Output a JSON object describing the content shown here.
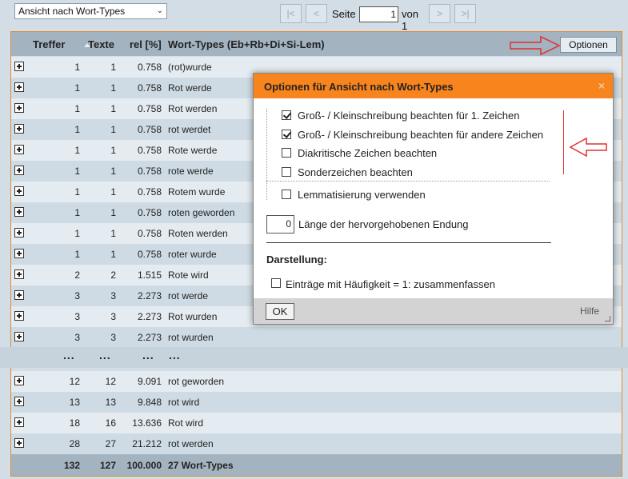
{
  "toolbar": {
    "view_select": "Ansicht nach Wort-Types",
    "pager": {
      "first": "|<",
      "prev": "<",
      "page_label": "Seite",
      "page_value": "1",
      "of_label": "von 1",
      "next": ">",
      "last": ">|"
    }
  },
  "table": {
    "headers": {
      "treffer": "Treffer",
      "texte": "Texte",
      "rel": "rel [%]",
      "wort": "Wort-Types (Eb+Rb+Di+Si-Lem)"
    },
    "options_button": "Optionen",
    "rows": [
      {
        "treffer": "1",
        "texte": "1",
        "rel": "0.758",
        "wort": "(rot)wurde"
      },
      {
        "treffer": "1",
        "texte": "1",
        "rel": "0.758",
        "wort": "Rot werde"
      },
      {
        "treffer": "1",
        "texte": "1",
        "rel": "0.758",
        "wort": "Rot werden"
      },
      {
        "treffer": "1",
        "texte": "1",
        "rel": "0.758",
        "wort": "rot werdet"
      },
      {
        "treffer": "1",
        "texte": "1",
        "rel": "0.758",
        "wort": "Rote werde"
      },
      {
        "treffer": "1",
        "texte": "1",
        "rel": "0.758",
        "wort": "rote werde"
      },
      {
        "treffer": "1",
        "texte": "1",
        "rel": "0.758",
        "wort": "Rotem wurde"
      },
      {
        "treffer": "1",
        "texte": "1",
        "rel": "0.758",
        "wort": "roten geworden"
      },
      {
        "treffer": "1",
        "texte": "1",
        "rel": "0.758",
        "wort": "Roten werden"
      },
      {
        "treffer": "1",
        "texte": "1",
        "rel": "0.758",
        "wort": "roter wurde"
      },
      {
        "treffer": "2",
        "texte": "2",
        "rel": "1.515",
        "wort": "Rote wird"
      },
      {
        "treffer": "3",
        "texte": "3",
        "rel": "2.273",
        "wort": "rot werde"
      },
      {
        "treffer": "3",
        "texte": "3",
        "rel": "2.273",
        "wort": "Rot wurden"
      },
      {
        "treffer": "3",
        "texte": "3",
        "rel": "2.273",
        "wort": "rot wurden"
      }
    ],
    "ellipsis": "...",
    "rows_bottom": [
      {
        "treffer": "12",
        "texte": "12",
        "rel": "9.091",
        "wort": "rot geworden"
      },
      {
        "treffer": "13",
        "texte": "13",
        "rel": "9.848",
        "wort": "rot wird"
      },
      {
        "treffer": "18",
        "texte": "16",
        "rel": "13.636",
        "wort": "Rot wird"
      },
      {
        "treffer": "28",
        "texte": "27",
        "rel": "21.212",
        "wort": "rot werden"
      }
    ],
    "total": {
      "treffer": "132",
      "texte": "127",
      "rel": "100.000",
      "wort": "27 Wort-Types"
    }
  },
  "dialog": {
    "title": "Optionen für Ansicht nach Wort-Types",
    "close": "×",
    "options": [
      {
        "label": "Groß- / Kleinschreibung beachten für 1. Zeichen",
        "checked": true
      },
      {
        "label": "Groß- / Kleinschreibung beachten für andere Zeichen",
        "checked": true
      },
      {
        "label": "Diakritische Zeichen beachten",
        "checked": false
      },
      {
        "label": "Sonderzeichen beachten",
        "checked": false
      },
      {
        "label": "Lemmatisierung verwenden",
        "checked": false
      }
    ],
    "length_value": "0",
    "length_label": "Länge der hervorgehobenen Endung",
    "section_title": "Darstellung:",
    "merge_option": {
      "label": "Einträge mit Häufigkeit = 1: zusammenfassen",
      "checked": false
    },
    "ok": "OK",
    "help": "Hilfe"
  },
  "colors": {
    "accent": "#f7841c",
    "frame": "#e08a33",
    "annotation": "#e03030",
    "header_bg": "#a3b3c0"
  }
}
